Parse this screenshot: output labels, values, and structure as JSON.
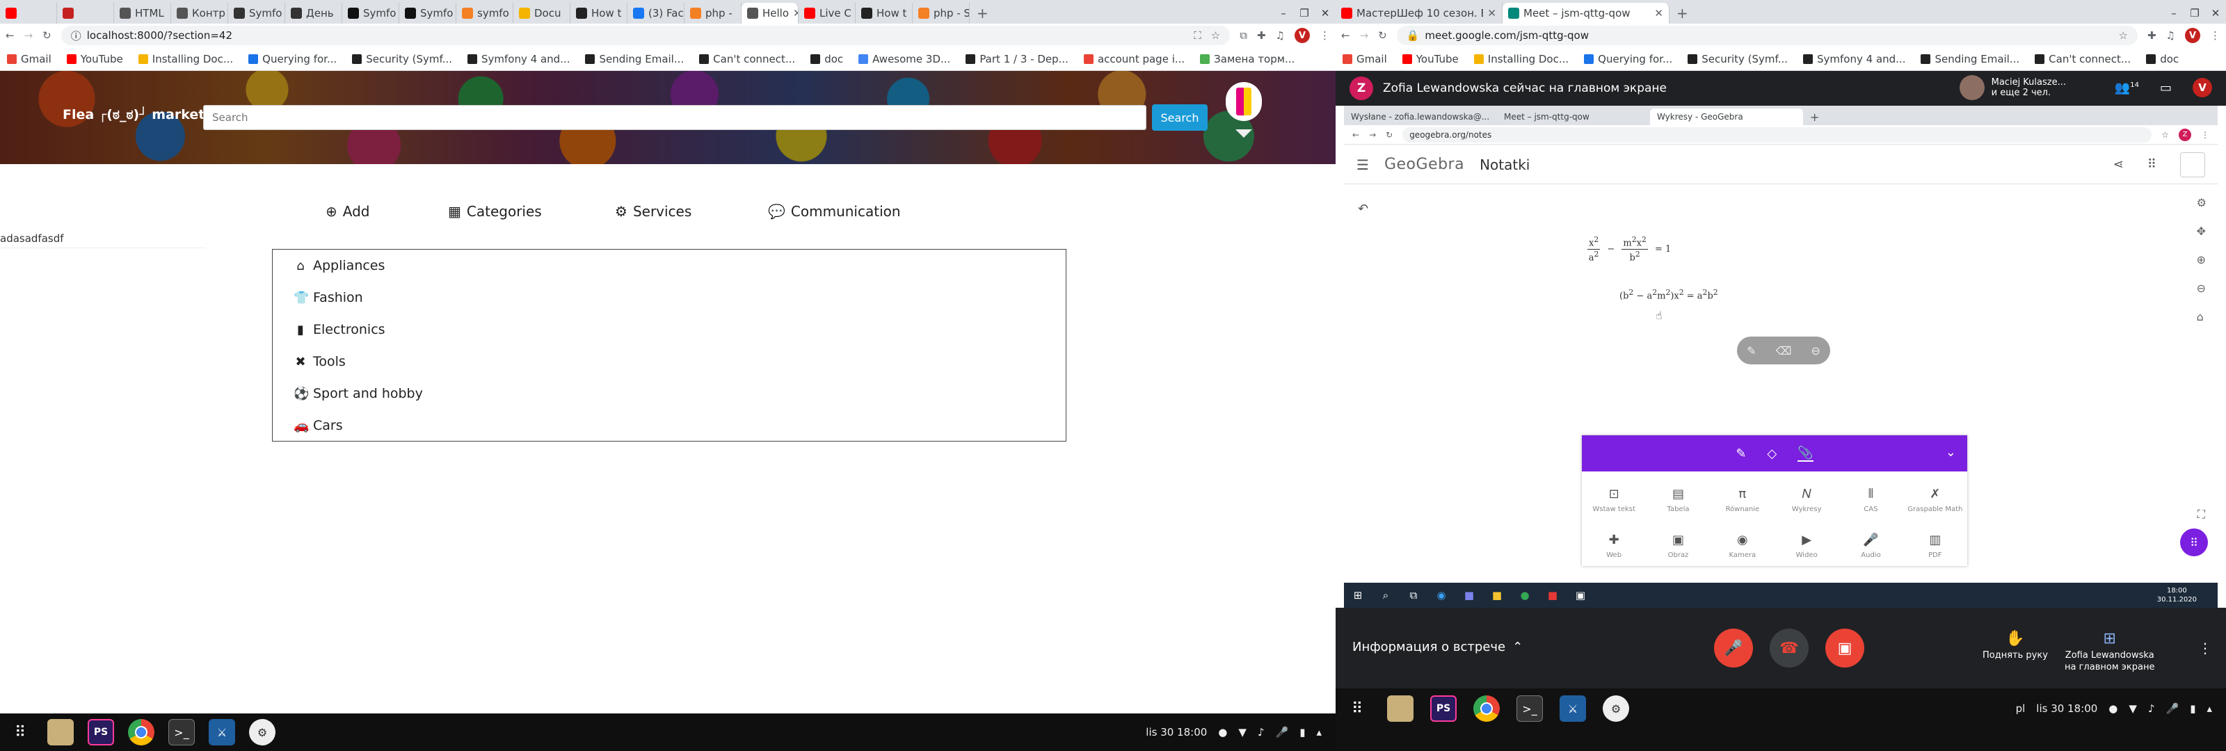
{
  "left": {
    "tabs": [
      {
        "label": "",
        "color": "#ff0000"
      },
      {
        "label": "",
        "color": "#c5221f"
      },
      {
        "label": "HTML",
        "color": "#555"
      },
      {
        "label": "Контр",
        "color": "#555"
      },
      {
        "label": "Symfo",
        "color": "#333"
      },
      {
        "label": "День",
        "color": "#333"
      },
      {
        "label": "Symfo",
        "color": "#111"
      },
      {
        "label": "Symfo",
        "color": "#111"
      },
      {
        "label": "symfo",
        "color": "#f48024"
      },
      {
        "label": "Docu",
        "color": "#f4b400"
      },
      {
        "label": "How t",
        "color": "#222"
      },
      {
        "label": "(3) Fac",
        "color": "#1877f2"
      },
      {
        "label": "php - ",
        "color": "#f48024"
      },
      {
        "label": "Hello",
        "color": "#555",
        "active": true
      },
      {
        "label": "Live C",
        "color": "#ff0000"
      },
      {
        "label": "How t",
        "color": "#222"
      },
      {
        "label": "php - S",
        "color": "#f48024"
      }
    ],
    "address": "localhost:8000/?section=42",
    "bookmarks": [
      "Gmail",
      "YouTube",
      "Installing Doc...",
      "Querying for...",
      "Security (Symf...",
      "Symfony 4 and...",
      "Sending Email...",
      "Can't connect...",
      "doc",
      "Awesome 3D...",
      "Part 1 / 3 - Dep...",
      "account page i...",
      "Замена торм..."
    ],
    "brand": "Flea ┌(ಠ_ಠ)┘ market",
    "search_placeholder": "Search",
    "search_button": "Search",
    "nav": [
      {
        "label": "Add",
        "icon": "⊕"
      },
      {
        "label": "Categories",
        "icon": "▦"
      },
      {
        "label": "Services",
        "icon": "⚙"
      },
      {
        "label": "Communication",
        "icon": "💬"
      }
    ],
    "side_text": "adasadfasdf",
    "categories": [
      {
        "label": "Appliances",
        "icon": "⌂"
      },
      {
        "label": "Fashion",
        "icon": "👕"
      },
      {
        "label": "Electronics",
        "icon": "▮"
      },
      {
        "label": "Tools",
        "icon": "✖"
      },
      {
        "label": "Sport and hobby",
        "icon": "⚽"
      },
      {
        "label": "Cars",
        "icon": "🚗"
      }
    ],
    "tray_clock": "lis 30  18:00"
  },
  "right": {
    "tabs": [
      {
        "label": "МастерШеф 10 сезон. Вы",
        "color": "#ff0000"
      },
      {
        "label": "Meet – jsm-qttg-qow",
        "color": "#00897b",
        "active": true
      }
    ],
    "address": "meet.google.com/jsm-qttg-qow",
    "bookmarks": [
      "Gmail",
      "YouTube",
      "Installing Doc...",
      "Querying for...",
      "Security (Symf...",
      "Symfony 4 and...",
      "Sending Email...",
      "Can't connect...",
      "doc"
    ],
    "meet_banner": "Zofia Lewandowska сейчас на главном экране",
    "presenter_line1": "Maciej Kulasze...",
    "presenter_line2": "и еще 2 чел.",
    "participants_count": "14",
    "inner_tabs": [
      "Wysłane - zofia.lewandowska@...",
      "Meet – jsm-qttg-qow",
      "Wykresy - GeoGebra"
    ],
    "inner_address": "geogebra.org/notes",
    "gg_logo": "GeoGebra",
    "gg_title": "Notatki",
    "gg_tools": [
      {
        "label": "Wstaw tekst",
        "icon": "⊡"
      },
      {
        "label": "Tabela",
        "icon": "▤"
      },
      {
        "label": "Równanie",
        "icon": "π"
      },
      {
        "label": "Wykresy",
        "icon": "𝑁"
      },
      {
        "label": "CAS",
        "icon": "⦀"
      },
      {
        "label": "Graspable Math",
        "icon": "✗"
      },
      {
        "label": "Web",
        "icon": "✚"
      },
      {
        "label": "Obraz",
        "icon": "▣"
      },
      {
        "label": "Kamera",
        "icon": "◉"
      },
      {
        "label": "Wideo",
        "icon": "▶"
      },
      {
        "label": "Audio",
        "icon": "🎤"
      },
      {
        "label": "PDF",
        "icon": "▥"
      }
    ],
    "win_clock_time": "18:00",
    "win_clock_date": "30.11.2020",
    "meet_info": "Информация о встрече",
    "raise_hand": "Поднять руку",
    "presenter_action_1": "Zofia Lewandowska",
    "presenter_action_2": "на главном экране",
    "lang": "pl",
    "tray_clock": "lis 30  18:00"
  }
}
